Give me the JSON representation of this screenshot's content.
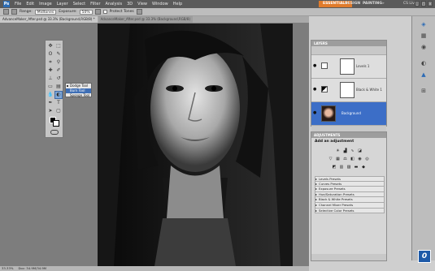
{
  "menubar": {
    "logo": "Ps",
    "items": [
      "File",
      "Edit",
      "Image",
      "Layer",
      "Select",
      "Filter",
      "Analysis",
      "3D",
      "View",
      "Window",
      "Help"
    ],
    "workspaces": {
      "essentials": "ESSENTIALS",
      "design": "DESIGN",
      "painting": "PAINTING",
      "more": "»"
    },
    "cslive": "CS Live"
  },
  "options": {
    "range_label": "Range:",
    "range_value": "Midtones",
    "exposure_label": "Exposure:",
    "exposure_value": "50%",
    "protect_tones": "Protect Tones"
  },
  "tabs": [
    {
      "label": "AdvanceMaker_After.psd @ 33.3% (Background,RGB/8) *"
    },
    {
      "label": "AdvanceMaker_After.psd @ 33.3% (Background,RGB/8)"
    }
  ],
  "flyout": {
    "items": [
      "Dodge Tool",
      "Burn Tool",
      "Sponge Tool"
    ],
    "active": "Burn Tool"
  },
  "layers_panel": {
    "title": "LAYERS",
    "layers": [
      {
        "name": "Levels 1"
      },
      {
        "name": "Black & White 1"
      },
      {
        "name": "Background"
      }
    ]
  },
  "adjustments_panel": {
    "title": "ADJUSTMENTS",
    "subtitle": "Add an adjustment",
    "presets": [
      "Levels Presets",
      "Curves Presets",
      "Exposure Presets",
      "Hue/Saturation Presets",
      "Black & White Presets",
      "Channel Mixer Presets",
      "Selective Color Presets"
    ]
  },
  "status": {
    "zoom": "33.33%",
    "doc": "Doc: 34.9M/34.9M"
  },
  "badge": "0"
}
